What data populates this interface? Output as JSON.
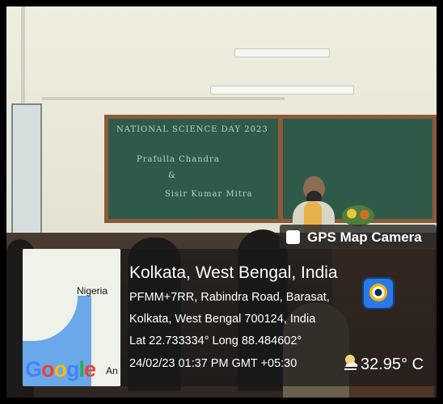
{
  "board": {
    "heading": "NATIONAL SCIENCE DAY 2023",
    "line_1": "Prafulla Chandra",
    "line_2": "&",
    "line_3": "Sisir Kumar Mitra"
  },
  "stamp": {
    "app_name": "GPS Map Camera",
    "location_title": "Kolkata, West Bengal, India",
    "address_line_1": "PFMM+7RR, Rabindra Road, Barasat,",
    "address_line_2": "Kolkata, West Bengal 700124, India",
    "coordinates": "Lat 22.733334° Long 88.484602°",
    "datetime": "24/02/23 01:37 PM GMT +05:30",
    "temperature": "32.95° C",
    "icon_camera": "camera-lens-icon",
    "icon_weather": "partly-cloudy-icon"
  },
  "map": {
    "label_nigeria": "Nigeria",
    "label_partial": "An",
    "provider": "Google",
    "colors": {
      "water": "#6aa8e9",
      "land": "#eef2e8"
    }
  },
  "colors": {
    "overlay": "#181818",
    "accent_blue": "#2a79e8",
    "chalkboard": "#2f5a4a"
  }
}
